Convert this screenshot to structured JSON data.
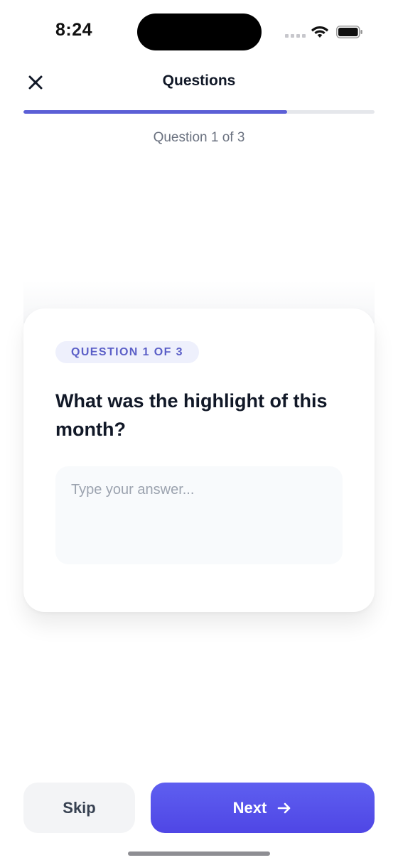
{
  "status_bar": {
    "time": "8:24",
    "icons": [
      "signal-icon",
      "wifi-icon",
      "battery-icon"
    ]
  },
  "header": {
    "title": "Questions",
    "close_icon": "close-icon"
  },
  "progress": {
    "fraction": 0.75,
    "label": "Question 1 of 3"
  },
  "card": {
    "badge": "QUESTION 1 OF 3",
    "question": "What was the highlight of this month?",
    "answer_placeholder": "Type your answer...",
    "answer_value": ""
  },
  "footer": {
    "skip_label": "Skip",
    "next_label": "Next",
    "next_icon": "arrow-right-icon"
  },
  "colors": {
    "accent": "#5b5fd6",
    "badge_bg": "#eef0fc",
    "badge_text": "#5b5fc7",
    "skip_bg": "#f3f4f6"
  }
}
